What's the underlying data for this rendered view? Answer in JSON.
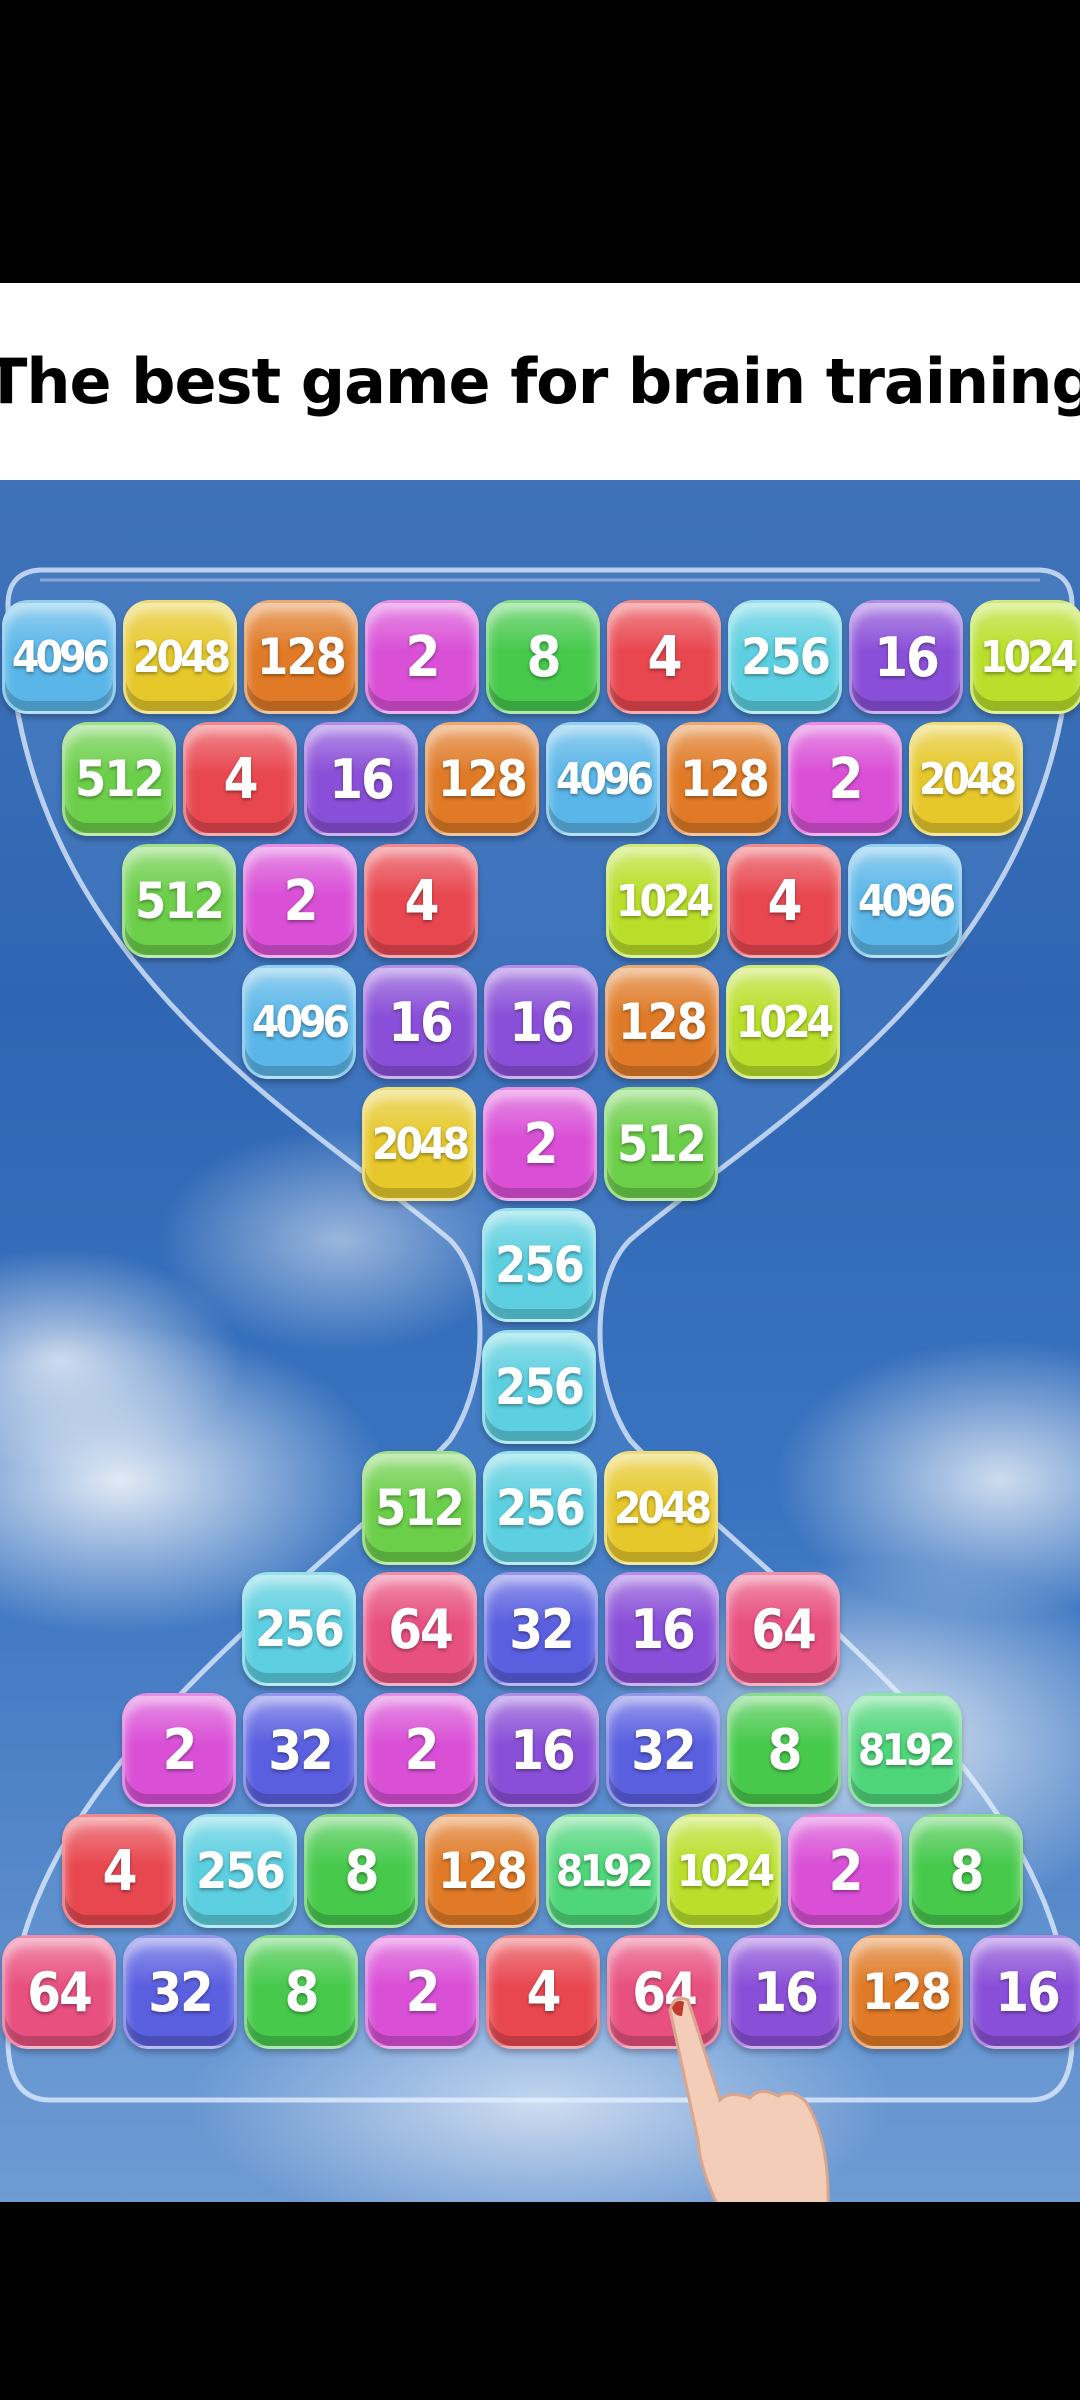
{
  "banner": {
    "title": "The best game for brain training"
  },
  "colors": {
    "2": "#d94fd6",
    "4": "#e8474f",
    "8": "#47c94c",
    "16": "#8a4fd8",
    "32": "#5a5fe0",
    "64": "#e8507f",
    "128": "#e07a26",
    "256": "#5ccfe0",
    "512": "#6ccf4a",
    "1024": "#b9df2a",
    "2048": "#e6c82a",
    "4096": "#5ab6e8",
    "8192": "#4fd67a"
  },
  "rows": [
    [
      4096,
      2048,
      128,
      2,
      8,
      4,
      256,
      16,
      1024
    ],
    [
      512,
      4,
      16,
      128,
      4096,
      128,
      2,
      2048
    ],
    [
      512,
      2,
      4,
      null,
      1024,
      4,
      4096
    ],
    [
      4096,
      16,
      16,
      128,
      1024
    ],
    [
      2048,
      2,
      512
    ],
    [
      256
    ],
    [
      256
    ],
    [
      512,
      256,
      2048
    ],
    [
      256,
      64,
      32,
      16,
      64
    ],
    [
      2,
      32,
      2,
      16,
      32,
      8,
      8192
    ],
    [
      4,
      256,
      8,
      128,
      8192,
      1024,
      2,
      8
    ],
    [
      64,
      32,
      8,
      2,
      4,
      64,
      16,
      128,
      16
    ]
  ]
}
